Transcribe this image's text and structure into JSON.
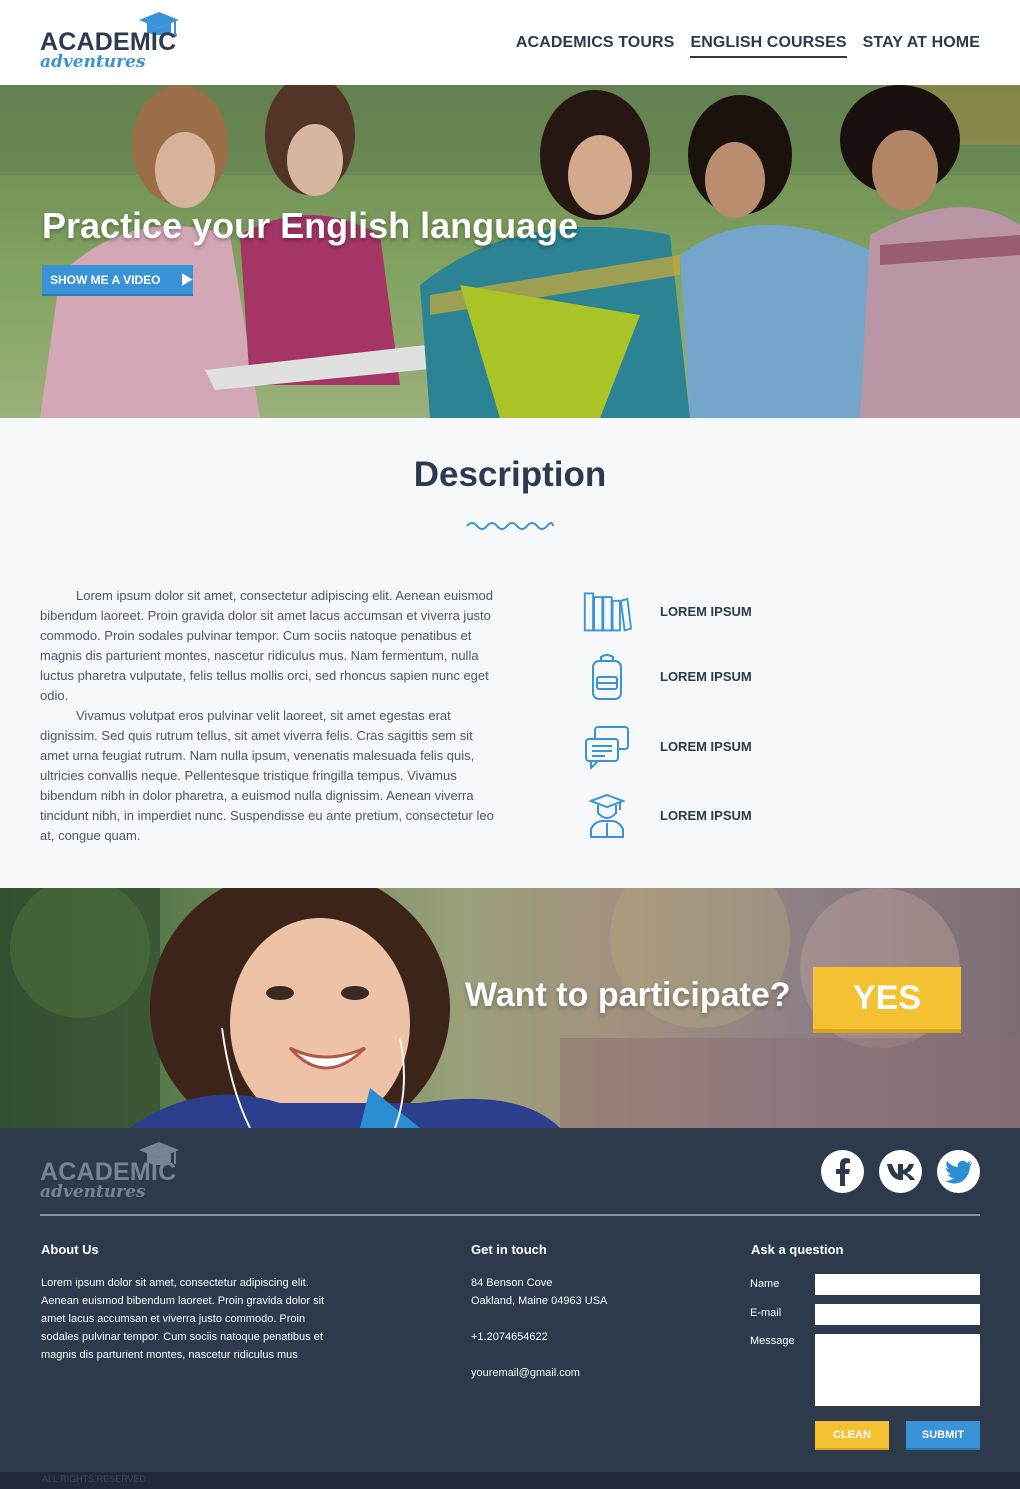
{
  "header": {
    "logo_main": "ACADEMIC",
    "logo_sub": "adventures",
    "nav": [
      {
        "label": "ACADEMICS TOURS"
      },
      {
        "label": "ENGLISH COURSES",
        "active": true
      },
      {
        "label": "STAY AT HOME"
      }
    ]
  },
  "hero": {
    "title": "Practice your English language",
    "button_label": "SHOW ME A VIDEO"
  },
  "description": {
    "title": "Description",
    "paragraphs": [
      "Lorem ipsum dolor sit amet, consectetur adipiscing elit. Aenean euismod bibendum laoreet. Proin gravida dolor sit amet lacus accumsan et viverra justo commodo. Proin sodales pulvinar tempor. Cum sociis natoque penatibus et magnis dis parturient montes, nascetur ridiculus mus. Nam fermentum, nulla luctus pharetra vulputate, felis tellus mollis orci, sed rhoncus sapien nunc eget odio.",
      "Vivamus volutpat eros pulvinar velit laoreet, sit amet egestas erat dignissim. Sed quis rutrum tellus, sit amet viverra felis. Cras sagittis sem sit amet urna feugiat rutrum. Nam nulla ipsum, venenatis malesuada felis quis, ultricies convallis neque. Pellentesque tristique fringilla tempus. Vivamus bibendum nibh in dolor pharetra, a euismod nulla dignissim. Aenean viverra tincidunt nibh, in imperdiet nunc. Suspendisse eu ante pretium, consectetur leo at, congue quam."
    ],
    "features": [
      {
        "label": "LOREM IPSUM",
        "icon": "books-icon"
      },
      {
        "label": "LOREM IPSUM",
        "icon": "backpack-icon"
      },
      {
        "label": "LOREM IPSUM",
        "icon": "chat-icon"
      },
      {
        "label": "LOREM IPSUM",
        "icon": "graduate-icon"
      }
    ]
  },
  "participate": {
    "question": "Want to participate?",
    "button_label": "YES"
  },
  "footer": {
    "logo_main": "ACADEMIC",
    "logo_sub": "adventures",
    "socials": [
      "facebook-icon",
      "vk-icon",
      "twitter-icon"
    ],
    "about_title": "About Us",
    "about_text": "Lorem ipsum dolor sit amet, consectetur adipiscing elit. Aenean euismod bibendum laoreet. Proin gravida dolor sit amet lacus accumsan et viverra justo commodo. Proin sodales pulvinar tempor. Cum sociis natoque penatibus et magnis dis parturient montes, nascetur ridiculus mus",
    "contact_title": "Get in touch",
    "address_line1": "84 Benson Cove",
    "address_line2": "Oakland, Maine 04963 USA",
    "phone": "+1.2074654622",
    "email": "youremail@gmail.com",
    "form_title": "Ask a question",
    "name_label": "Name",
    "email_label": "E-mail",
    "message_label": "Message",
    "name_value": "",
    "email_value": "",
    "message_value": "",
    "clean_label": "CLEAN",
    "submit_label": "SUBMIT",
    "copyright": "ALL RIGHTS RESERVED"
  },
  "colors": {
    "primary_dark": "#2b3a4e",
    "accent_blue": "#3a93d6",
    "accent_yellow": "#f4c133",
    "footer_bg": "#2c3a4c"
  }
}
